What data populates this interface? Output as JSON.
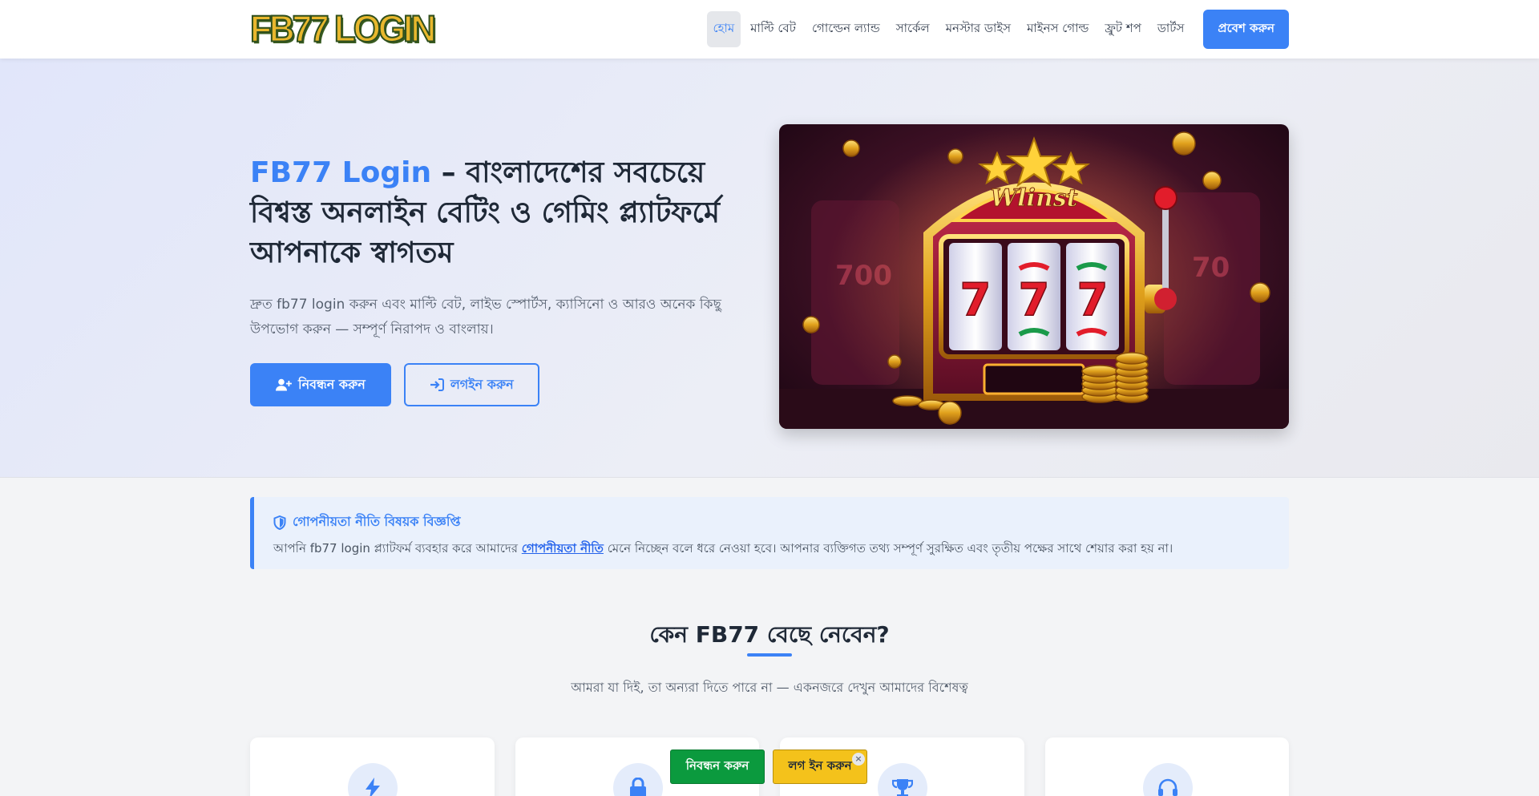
{
  "header": {
    "logo_text": "FB77 LOGIN",
    "nav": [
      "হোম",
      "মাল্টি বেট",
      "গোল্ডেন ল্যান্ড",
      "সার্কেল",
      "মনস্টার ডাইস",
      "মাইনস গোল্ড",
      "ফ্রুট শপ",
      "ডার্টস"
    ],
    "cta": "প্রবেশ করুন"
  },
  "hero": {
    "title_brand": "FB77 Login",
    "title_rest": " – বাংলাদেশের সবচেয়ে বিশ্বস্ত অনলাইন বেটিং ও গেমিং প্ল্যাটফর্মে আপনাকে স্বাগতম",
    "subtitle": "দ্রুত fb77 login করুন এবং মাল্টি বেট, লাইভ স্পোর্টস, ক্যাসিনো ও আরও অনেক কিছু উপভোগ করুন — সম্পূর্ণ নিরাপদ ও বাংলায়।",
    "register_label": "নিবন্ধন করুন",
    "login_label": "লগইন করুন",
    "image_sign": "Wlinst"
  },
  "notice": {
    "title": "গোপনীয়তা নীতি বিষয়ক বিজ্ঞপ্তি",
    "body_before": "আপনি fb77 login প্ল্যাটফর্ম ব্যবহার করে আমাদের ",
    "link": "গোপনীয়তা নীতি",
    "body_after": " মেনে নিচ্ছেন বলে ধরে নেওয়া হবে। আপনার ব্যক্তিগত তথ্য সম্পূর্ণ সুরক্ষিত এবং তৃতীয় পক্ষের সাথে শেয়ার করা হয় না।"
  },
  "section": {
    "title": "কেন FB77 বেছে নেবেন?",
    "subtitle": "আমরা যা দিই, তা অন্যরা দিতে পারে না — একনজরে দেখুন আমাদের বিশেষত্ব"
  },
  "cards": [
    {
      "icon": "bolt-icon"
    },
    {
      "icon": "lock-icon"
    },
    {
      "icon": "trophy-icon"
    },
    {
      "icon": "headset-icon"
    }
  ],
  "floating": {
    "register": "নিবন্ধন করুন",
    "login": "লগ ইন করুন",
    "close": "×"
  },
  "colors": {
    "accent": "#3b82f6",
    "float_register": "#0b9a3e",
    "float_login": "#f4c21b"
  }
}
